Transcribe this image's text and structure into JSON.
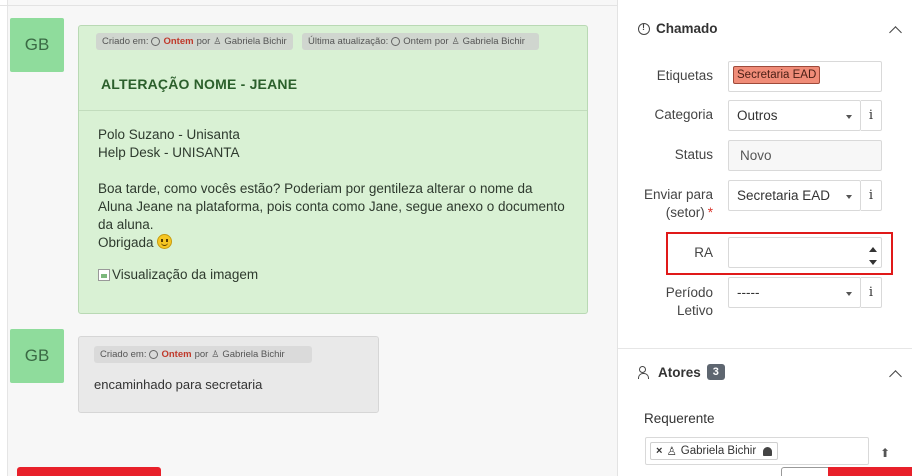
{
  "timeline": {
    "followup1": {
      "avatar": "GB",
      "created_label": "Criado em:",
      "created_when": "Ontem",
      "by_label": "por",
      "author": "Gabriela Bichir",
      "updated_label": "Última atualização:",
      "updated_when": "Ontem",
      "updated_by_label": "por",
      "updated_author": "Gabriela Bichir",
      "title": "ALTERAÇÃO NOME - JEANE",
      "lines": [
        "Polo Suzano - Unisanta",
        "Help Desk - UNISANTA"
      ],
      "message": "Boa tarde, como vocês estão? Poderiam por gentileza alterar o nome da Aluna Jeane na plataforma, pois conta como Jane, segue anexo o documento da aluna.",
      "signoff": "Obrigada",
      "image_alt": "Visualização da imagem"
    },
    "followup2": {
      "avatar": "GB",
      "created_label": "Criado em:",
      "created_when": "Ontem",
      "by_label": "por",
      "author": "Gabriela Bichir",
      "text": "encaminhado para secretaria"
    }
  },
  "panel": {
    "ticket_section": {
      "title": "Chamado",
      "labels": {
        "tags": "Etiquetas",
        "category": "Categoria",
        "status": "Status",
        "send_to_line1": "Enviar para",
        "send_to_line2": "(setor)",
        "required_mark": "*",
        "ra": "RA",
        "period_line1": "Período",
        "period_line2": "Letivo"
      },
      "tag_value": "Secretaria EAD",
      "category_value": "Outros",
      "status_value": "Novo",
      "send_to_value": "Secretaria EAD",
      "ra_value": "",
      "period_value": "-----",
      "info_glyph": "i"
    },
    "actors_section": {
      "title": "Atores",
      "count": "3",
      "requester_label": "Requerente",
      "requester_remove": "×",
      "requester_name": "Gabriela Bichir"
    }
  },
  "colors": {
    "highlight": "#e01919",
    "bubble_green": "#d9f1d4",
    "avatar_green": "#8fdc9c",
    "tag_bg": "#f08c78"
  }
}
